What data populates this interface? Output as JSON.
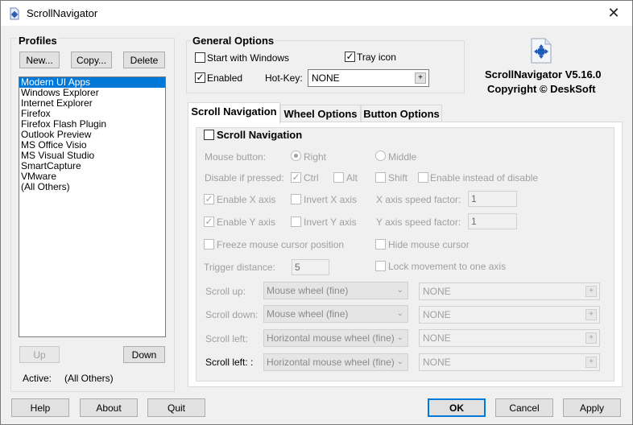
{
  "window": {
    "title": "ScrollNavigator",
    "close_glyph": "✕"
  },
  "profiles": {
    "heading": "Profiles",
    "buttons": {
      "new": "New...",
      "copy": "Copy...",
      "delete": "Delete",
      "up": "Up",
      "down": "Down"
    },
    "items": [
      "Modern UI Apps",
      "Windows Explorer",
      "Internet Explorer",
      "Firefox",
      "Firefox Flash Plugin",
      "Outlook Preview",
      "MS Office Visio",
      "MS Visual Studio",
      "SmartCapture",
      "VMware",
      "(All Others)"
    ],
    "selected_index": 0,
    "active_label": "Active:",
    "active_value": "(All Others)"
  },
  "general": {
    "heading": "General Options",
    "start_with_windows": {
      "label": "Start with Windows",
      "checked": false
    },
    "tray_icon": {
      "label": "Tray icon",
      "checked": true
    },
    "enabled": {
      "label": "Enabled",
      "checked": true
    },
    "hotkey_label": "Hot-Key:",
    "hotkey_value": "NONE",
    "plus_glyph": "+"
  },
  "about": {
    "version": "ScrollNavigator V5.16.0",
    "copyright": "Copyright © DeskSoft"
  },
  "tabs": [
    "Scroll Navigation",
    "Wheel Options",
    "Button Options"
  ],
  "scroll_nav": {
    "heading": "Scroll Navigation",
    "mouse_button_label": "Mouse button:",
    "right": "Right",
    "middle": "Middle",
    "disable_if_pressed_label": "Disable if pressed:",
    "ctrl": "Ctrl",
    "alt": "Alt",
    "shift": "Shift",
    "enable_instead": "Enable instead of disable",
    "enable_x": "Enable X axis",
    "invert_x": "Invert X axis",
    "x_speed_label": "X axis speed factor:",
    "x_speed_value": "1",
    "enable_y": "Enable Y axis",
    "invert_y": "Invert Y axis",
    "y_speed_label": "Y axis speed factor:",
    "y_speed_value": "1",
    "freeze": "Freeze mouse cursor position",
    "hide_cursor": "Hide mouse cursor",
    "trigger_label": "Trigger distance:",
    "trigger_value": "5",
    "lock_movement": "Lock movement to one axis",
    "rows": [
      {
        "label": "Scroll up:",
        "action": "Mouse wheel (fine)",
        "hotkey": "NONE"
      },
      {
        "label": "Scroll down:",
        "action": "Mouse wheel (fine)",
        "hotkey": "NONE"
      },
      {
        "label": "Scroll left:",
        "action": "Horizontal mouse wheel (fine)",
        "hotkey": "NONE"
      },
      {
        "label": "Scroll left: :",
        "action": "Horizontal mouse wheel (fine)",
        "hotkey": "NONE"
      }
    ],
    "check_glyph": "✓",
    "chevron_glyph": "⌄"
  },
  "footer": {
    "help": "Help",
    "about": "About",
    "quit": "Quit",
    "ok": "OK",
    "cancel": "Cancel",
    "apply": "Apply"
  }
}
